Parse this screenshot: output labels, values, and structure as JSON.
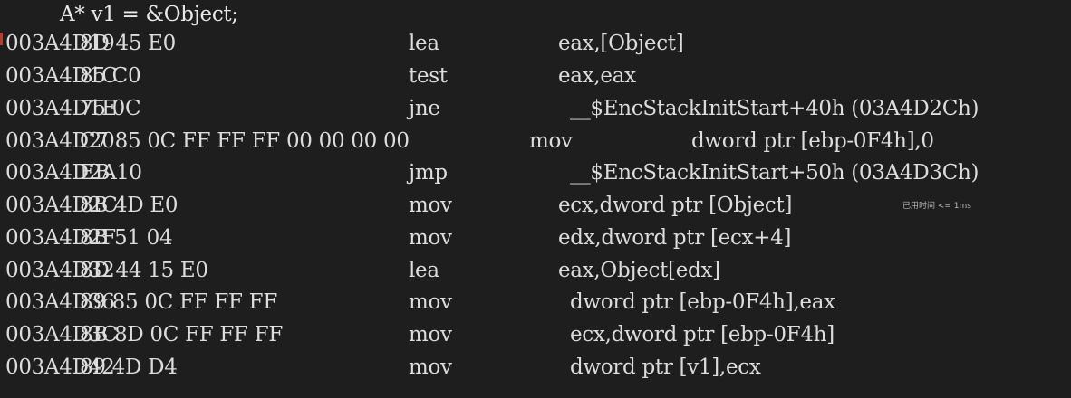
{
  "source_line": "A* v1 = &Object;",
  "asm": [
    {
      "address": "003A4D19",
      "bytes": "8D 45 E0",
      "mnemonic": "lea",
      "operands": "eax,[Object]"
    },
    {
      "address": "003A4D1C",
      "bytes": "85 C0",
      "mnemonic": "test",
      "operands": "eax,eax"
    },
    {
      "address": "003A4D1E",
      "bytes": "75 0C",
      "mnemonic": "jne",
      "operands": "__$EncStackInitStart+40h (03A4D2Ch)"
    },
    {
      "address": "003A4D20",
      "bytes": "C7 85 0C FF FF FF 00 00 00 00",
      "mnemonic": "mov",
      "operands": "dword ptr [ebp-0F4h],0"
    },
    {
      "address": "003A4D2A",
      "bytes": "EB 10",
      "mnemonic": "jmp",
      "operands": "__$EncStackInitStart+50h (03A4D3Ch)"
    },
    {
      "address": "003A4D2C",
      "bytes": "8B 4D E0",
      "mnemonic": "mov",
      "operands": "ecx,dword ptr [Object]"
    },
    {
      "address": "003A4D2F",
      "bytes": "8B 51 04",
      "mnemonic": "mov",
      "operands": "edx,dword ptr [ecx+4]"
    },
    {
      "address": "003A4D32",
      "bytes": "8D 44 15 E0",
      "mnemonic": "lea",
      "operands": "eax,Object[edx]"
    },
    {
      "address": "003A4D36",
      "bytes": "89 85 0C FF FF FF",
      "mnemonic": "mov",
      "operands": "dword ptr [ebp-0F4h],eax"
    },
    {
      "address": "003A4D3C",
      "bytes": "8B 8D 0C FF FF FF",
      "mnemonic": "mov",
      "operands": "ecx,dword ptr [ebp-0F4h]"
    },
    {
      "address": "003A4D42",
      "bytes": "89 4D D4",
      "mnemonic": "mov",
      "operands": "dword ptr [v1],ecx"
    }
  ],
  "elapsed_hint": "已用时间 <= 1ms",
  "colors": {
    "background": "#1e1e1e",
    "text": "#dcdcdc",
    "breakpoint": "#c0392b"
  }
}
